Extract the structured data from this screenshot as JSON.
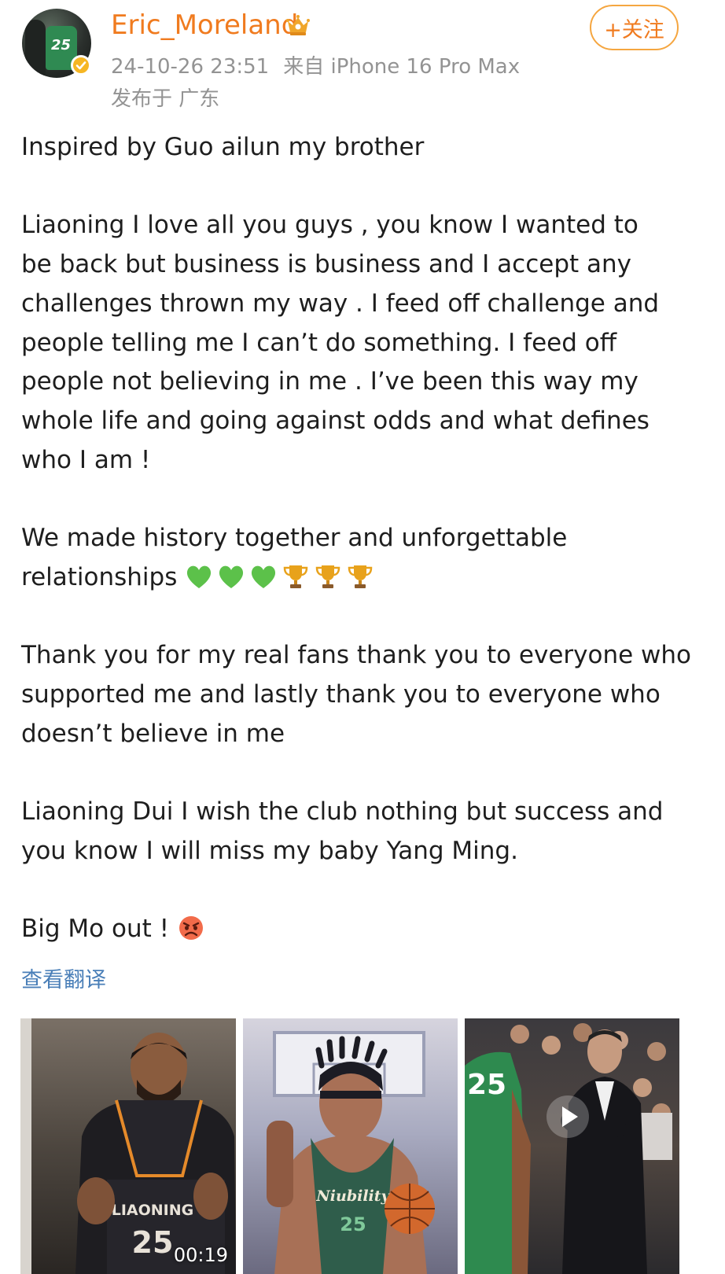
{
  "header": {
    "username": "Eric_Moreland",
    "avatar_jersey_number": "25",
    "meta": {
      "timestamp": "24-10-26 23:51",
      "source": "来自 iPhone 16 Pro Max"
    },
    "location": "发布于 广东",
    "follow_label": "+关注",
    "icons": {
      "crown": "crown-icon",
      "verified": "verified-badge-icon"
    }
  },
  "post": {
    "line1": "Inspired by Guo ailun my brother",
    "para2": "Liaoning I love all you guys , you know I wanted to\nbe back but business is business and I accept any\nchallenges thrown my way . I feed off challenge and\npeople telling me I can’t do something. I feed off\npeople not believing in me . I’ve been this way my\nwhole life and going against odds and what defines\nwho I am !",
    "para3_line1": "We made history together and unforgettable",
    "para3_line2": "relationships",
    "para4": "Thank you for my real fans thank you to everyone who\nsupported me and lastly thank you to everyone who\ndoesn’t believe in me",
    "para5": "Liaoning Dui I wish the club nothing but success and\nyou know I will miss my baby Yang Ming.",
    "para6": "Big Mo out !",
    "emojis": [
      "green-heart",
      "green-heart",
      "green-heart",
      "trophy",
      "trophy",
      "trophy",
      "angry-face"
    ]
  },
  "translate_label": "查看翻译",
  "media": [
    {
      "type": "video",
      "duration": "00:19",
      "jersey_text": "LIAONING",
      "jersey_number": "25"
    },
    {
      "type": "image",
      "jersey_text": "Niubility",
      "jersey_number": "25"
    },
    {
      "type": "video",
      "jersey_number": "25"
    }
  ],
  "colors": {
    "username": "#f07b1f",
    "follow_border": "#f5a640",
    "meta": "#939393",
    "link": "#4a7fb8",
    "green_heart": "#5cc14a",
    "trophy": "#e8a21b"
  }
}
